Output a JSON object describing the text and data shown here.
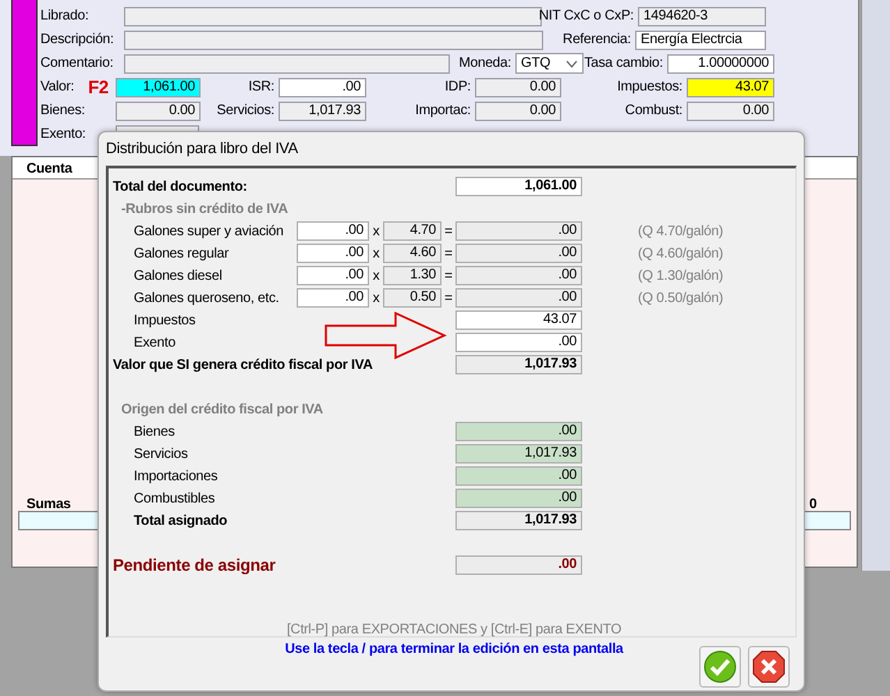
{
  "form": {
    "fields": [
      {
        "label": "Librado:",
        "color": "#eeeef0"
      },
      {
        "label": "NIT CxC o CxP:",
        "value": "1494620-3",
        "color": "#eeeef0"
      },
      {
        "label": "Descripción:",
        "color": "#eeeef0"
      },
      {
        "label": "Referencia:",
        "value": "Energía Electrcia",
        "color": "#ffffff"
      },
      {
        "label": "Comentario:",
        "color": "#eeeef0"
      },
      {
        "label": "Moneda:",
        "value": "GTQ",
        "kind": "select",
        "color": "#ffffff"
      },
      {
        "label": "Tasa cambio:",
        "value": "1.00000000",
        "color": "#ffffff"
      },
      {
        "label": "Valor:",
        "hotkey": "F2",
        "value": "1,061.00",
        "color": "#00ffff"
      },
      {
        "label": "ISR:",
        "value": ".00",
        "color": "#ffffff"
      },
      {
        "label": "IDP:",
        "value": "0.00",
        "color": "#eeeef0"
      },
      {
        "label": "Impuestos:",
        "value": "43.07",
        "color": "#ffff00"
      },
      {
        "label": "Bienes:",
        "value": "0.00",
        "color": "#eeeef0"
      },
      {
        "label": "Servicios:",
        "value": "1,017.93",
        "color": "#eeeef0"
      },
      {
        "label": "Importac:",
        "value": "0.00",
        "color": "#eeeef0"
      },
      {
        "label": "Combust:",
        "value": "0.00",
        "color": "#eeeef0"
      },
      {
        "label": "Exento:",
        "color": "#eeeef0"
      }
    ]
  },
  "table": {
    "columns": [
      "Cuenta"
    ],
    "totals_label": "Sumas",
    "totals_value": "0"
  },
  "dialog": {
    "title": "Distribución para libro del IVA",
    "total": {
      "label": "Total del documento:",
      "value": "1,061.00"
    },
    "section1": "-Rubros sin crédito de IVA",
    "fuel": [
      {
        "label": "Galones super y aviación",
        "gallons": ".00",
        "times": "x",
        "rate": "4.70",
        "equals": "=",
        "result": ".00",
        "hint": "(Q 4.70/galón)"
      },
      {
        "label": "Galones regular",
        "gallons": ".00",
        "times": "x",
        "rate": "4.60",
        "equals": "=",
        "result": ".00",
        "hint": "(Q 4.60/galón)"
      },
      {
        "label": "Galones diesel",
        "gallons": ".00",
        "times": "x",
        "rate": "1.30",
        "equals": "=",
        "result": ".00",
        "hint": "(Q 1.30/galón)"
      },
      {
        "label": "Galones queroseno, etc.",
        "gallons": ".00",
        "times": "x",
        "rate": "0.50",
        "equals": "=",
        "result": ".00",
        "hint": "(Q 0.50/galón)"
      }
    ],
    "extra": [
      {
        "label": "Impuestos",
        "value": "43.07"
      },
      {
        "label": "Exento",
        "value": ".00"
      }
    ],
    "credit": {
      "label": "Valor que SI genera crédito fiscal por IVA",
      "value": "1,017.93"
    },
    "section2": "Origen del crédito fiscal por IVA",
    "origin": [
      {
        "label": "Bienes",
        "value": ".00"
      },
      {
        "label": "Servicios",
        "value": "1,017.93"
      },
      {
        "label": "Importaciones",
        "value": ".00"
      },
      {
        "label": "Combustibles",
        "value": ".00"
      }
    ],
    "assigned": {
      "label": "Total asignado",
      "value": "1,017.93"
    },
    "pending": {
      "label": "Pendiente de asignar",
      "value": ".00"
    },
    "hint1": "[Ctrl-P] para EXPORTACIONES y [Ctrl-E] para EXENTO",
    "hint2": "Use la tecla / para terminar la edición en esta pantalla"
  }
}
